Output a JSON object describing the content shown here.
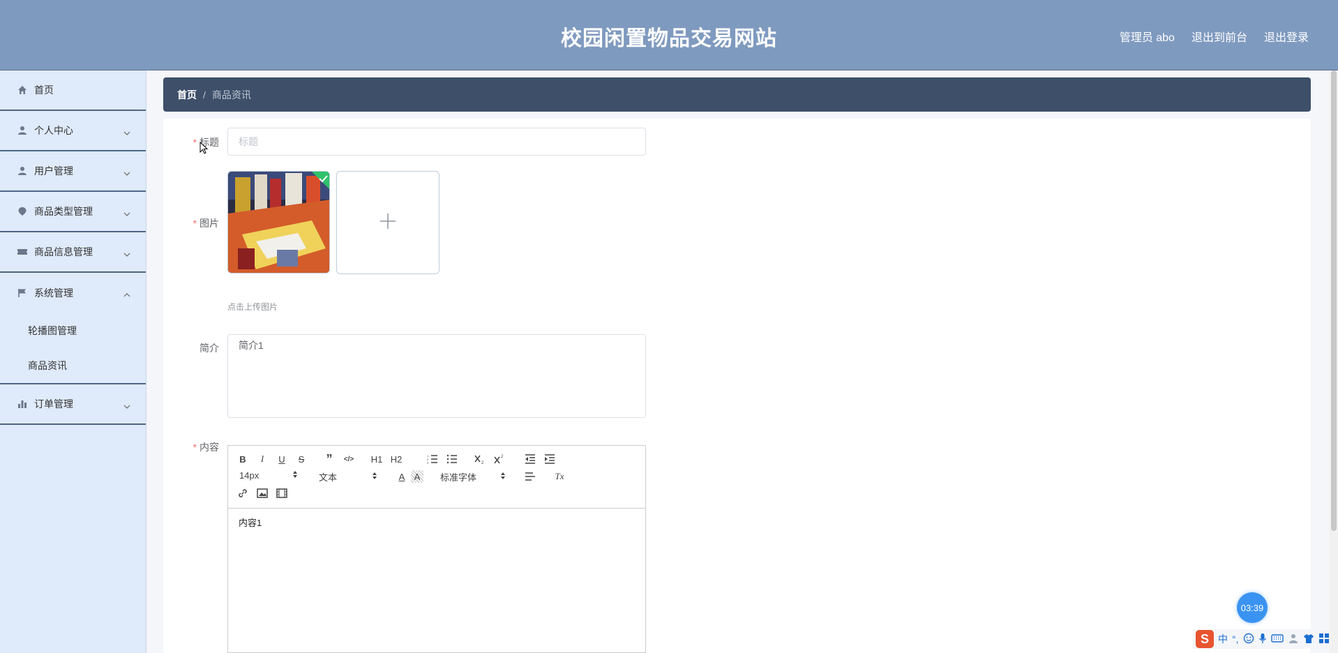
{
  "header": {
    "title": "校园闲置物品交易网站",
    "admin": "管理员 abo",
    "to_front": "退出到前台",
    "logout": "退出登录"
  },
  "sidebar": {
    "items": [
      {
        "label": "首页",
        "icon": "home-icon"
      },
      {
        "label": "个人中心",
        "icon": "user-icon"
      },
      {
        "label": "用户管理",
        "icon": "user-icon"
      },
      {
        "label": "商品类型管理",
        "icon": "location-icon"
      },
      {
        "label": "商品信息管理",
        "icon": "ticket-icon"
      },
      {
        "label": "系统管理",
        "icon": "flag-icon"
      },
      {
        "label": "订单管理",
        "icon": "bar-chart-icon"
      }
    ],
    "sub_items": [
      "轮播图管理",
      "商品资讯"
    ]
  },
  "breadcrumb": {
    "home": "首页",
    "separator": "/",
    "current": "商品资讯"
  },
  "form": {
    "title_label": "标题",
    "title_placeholder": "标题",
    "title_value": "",
    "image_label": "图片",
    "upload_tip": "点击上传图片",
    "desc_label": "简介",
    "desc_value": "简介1",
    "content_label": "内容",
    "content_value": "内容1",
    "required_mark": "*"
  },
  "editor": {
    "font_size": "14px",
    "header_type": "文本",
    "font_family": "标准字体",
    "buttons": [
      "B",
      "I",
      "U",
      "S",
      "”",
      "</>",
      "H1",
      "H2",
      "ol",
      "ul",
      "x2",
      "x2",
      "outdent",
      "indent",
      "A",
      "A",
      "align",
      "Tx",
      "link",
      "image",
      "video"
    ]
  },
  "timer": "03:39",
  "ime": {
    "logo": "S",
    "lang": "中",
    "punct": "°,"
  },
  "colors": {
    "header_bg": "#7f9abf",
    "sidebar_bg": "#dfeafa",
    "breadcrumb_bg": "#3d4f69",
    "required": "#f56c6c",
    "timer_bg": "#3a93f2"
  }
}
